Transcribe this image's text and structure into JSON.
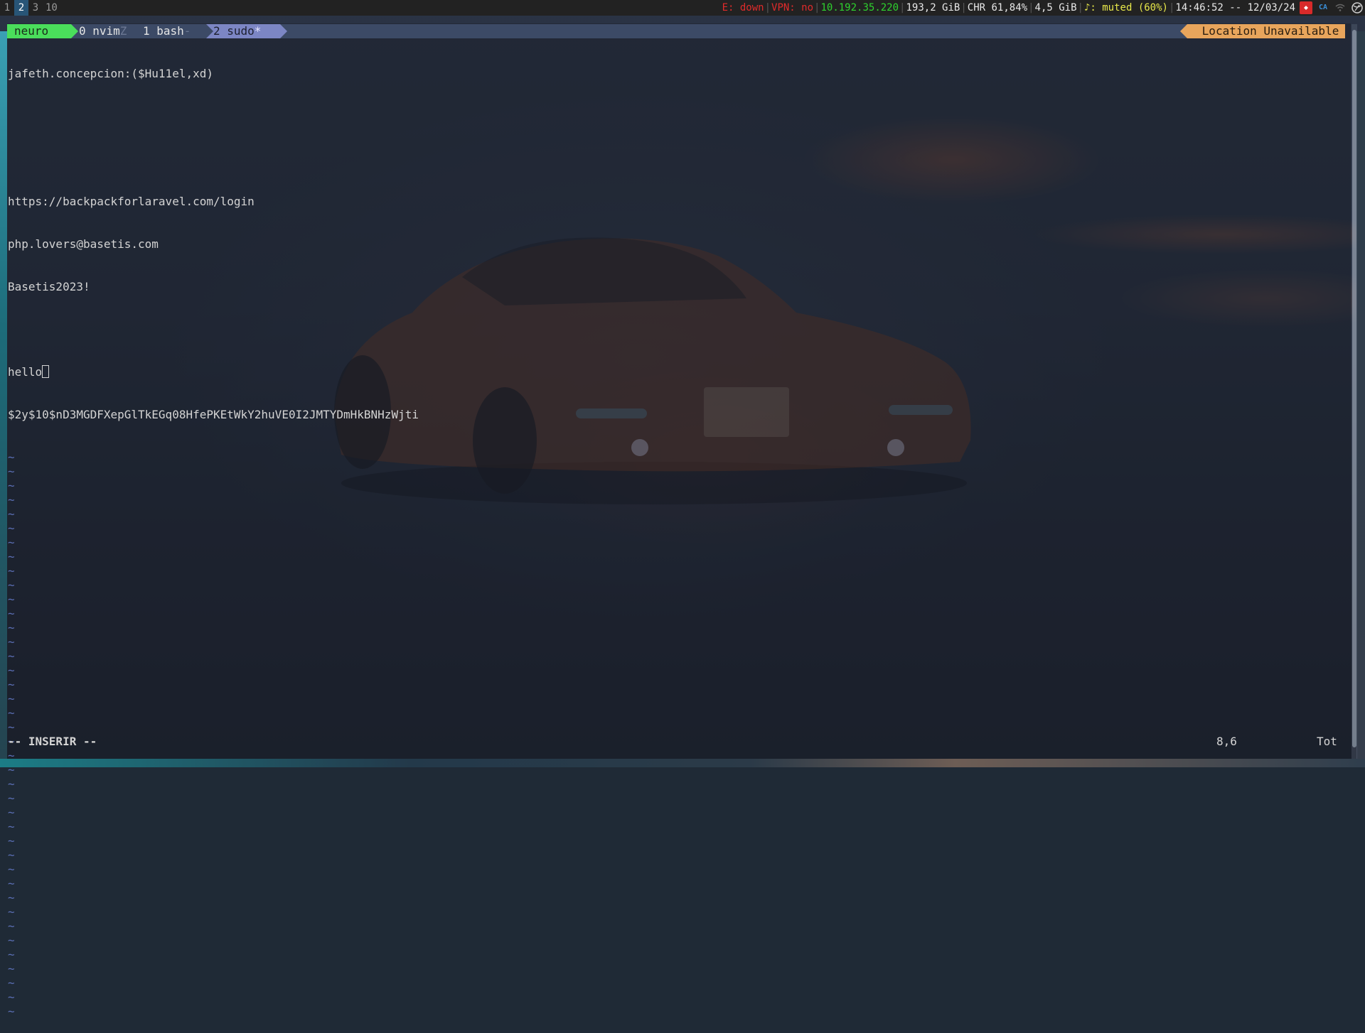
{
  "topbar": {
    "workspaces": [
      {
        "label": "1",
        "active": false
      },
      {
        "label": "2",
        "active": true
      },
      {
        "label": "3",
        "active": false
      },
      {
        "label": "10",
        "active": false
      }
    ],
    "ethernet": "E: down",
    "vpn": "VPN: no",
    "ip": "10.192.35.220",
    "disk": "193,2 GiB",
    "battery": "CHR 61,84%",
    "memory": "4,5 GiB",
    "volume": "♪: muted (60%)",
    "datetime": "14:46:52 -- 12/03/24",
    "tray_icons": [
      "anydesk-icon",
      "ca-icon",
      "wifi-icon",
      "network-globe-icon"
    ],
    "tray_ca_label": "CA"
  },
  "tmux": {
    "session": "neuro",
    "windows": [
      {
        "index_label": "0 nvim",
        "flag": "Z"
      },
      {
        "index_label": "1 bash",
        "flag": "-"
      },
      {
        "index_label": "2 sudo",
        "flag": "*"
      }
    ],
    "status_right": "Location Unavailable"
  },
  "editor": {
    "lines": [
      "jafeth.concepcion:($Hu11el,xd)",
      "",
      "",
      "https://backpackforlaravel.com/login",
      "php.lovers@basetis.com",
      "Basetis2023!",
      "",
      "hello",
      "$2y$10$nD3MGDFXepGlTkEGq08HfePKEtWkY2huVE0I2JMTYDmHkBNHzWjti"
    ],
    "tilde": "~",
    "mode": "-- INSERIR --",
    "cursor_pos": "8,6",
    "scroll": "Tot"
  },
  "colors": {
    "workspace_active": "#285577",
    "tmux_session": "#4ade5b",
    "tmux_active_window": "#7c86c4",
    "tmux_status_right": "#e8a55c",
    "tilde": "#5b6fb5"
  }
}
